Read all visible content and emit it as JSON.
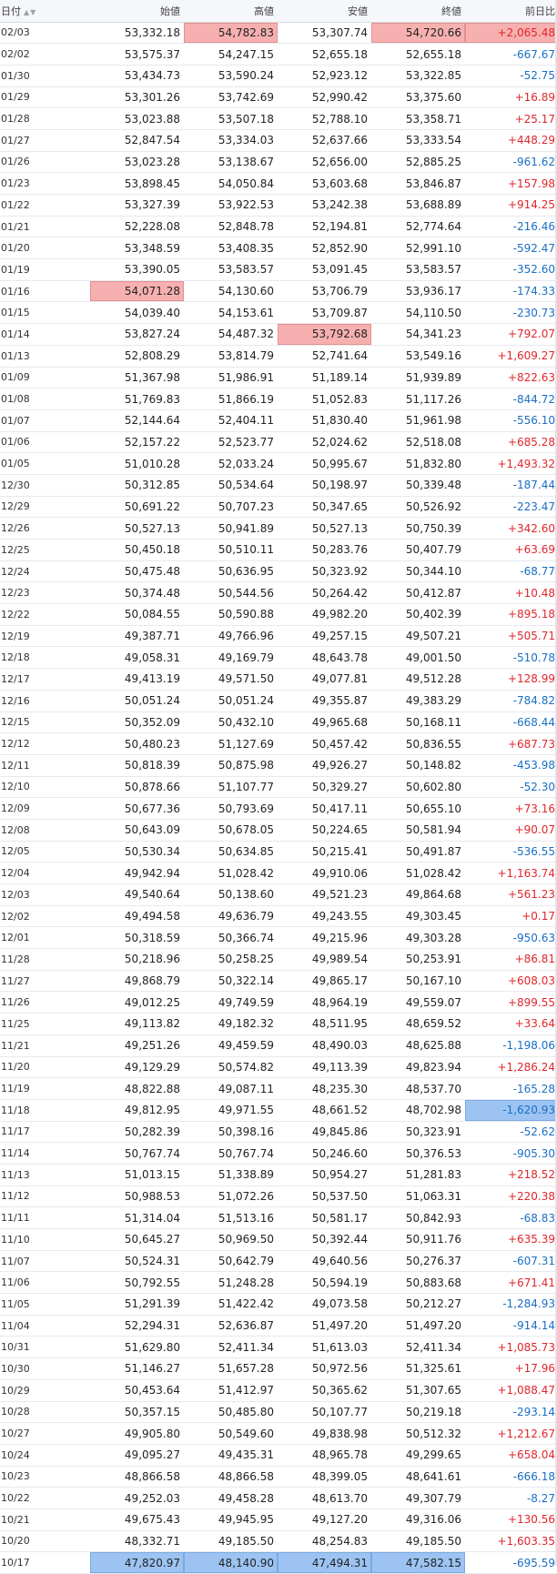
{
  "table": {
    "headers": {
      "date": "日付",
      "sort_icon": "▲▼",
      "open": "始値",
      "high": "高値",
      "low": "安値",
      "close": "終値",
      "change": "前日比"
    },
    "highlight_colors": {
      "high": "#f7b0b0",
      "low": "#9cc3f2",
      "up": "#e0262b",
      "down": "#1a6fc4"
    },
    "rows": [
      {
        "date": "02/03",
        "open": "53,332.18",
        "high": "54,782.83",
        "low": "53,307.74",
        "close": "54,720.66",
        "change": "+2,065.48",
        "hl": {
          "high": "hi",
          "close": "hi",
          "change": "hi"
        }
      },
      {
        "date": "02/02",
        "open": "53,575.37",
        "high": "54,247.15",
        "low": "52,655.18",
        "close": "52,655.18",
        "change": "-667.67"
      },
      {
        "date": "01/30",
        "open": "53,434.73",
        "high": "53,590.24",
        "low": "52,923.12",
        "close": "53,322.85",
        "change": "-52.75"
      },
      {
        "date": "01/29",
        "open": "53,301.26",
        "high": "53,742.69",
        "low": "52,990.42",
        "close": "53,375.60",
        "change": "+16.89"
      },
      {
        "date": "01/28",
        "open": "53,023.88",
        "high": "53,507.18",
        "low": "52,788.10",
        "close": "53,358.71",
        "change": "+25.17"
      },
      {
        "date": "01/27",
        "open": "52,847.54",
        "high": "53,334.03",
        "low": "52,637.66",
        "close": "53,333.54",
        "change": "+448.29"
      },
      {
        "date": "01/26",
        "open": "53,023.28",
        "high": "53,138.67",
        "low": "52,656.00",
        "close": "52,885.25",
        "change": "-961.62"
      },
      {
        "date": "01/23",
        "open": "53,898.45",
        "high": "54,050.84",
        "low": "53,603.68",
        "close": "53,846.87",
        "change": "+157.98"
      },
      {
        "date": "01/22",
        "open": "53,327.39",
        "high": "53,922.53",
        "low": "53,242.38",
        "close": "53,688.89",
        "change": "+914.25"
      },
      {
        "date": "01/21",
        "open": "52,228.08",
        "high": "52,848.78",
        "low": "52,194.81",
        "close": "52,774.64",
        "change": "-216.46"
      },
      {
        "date": "01/20",
        "open": "53,348.59",
        "high": "53,408.35",
        "low": "52,852.90",
        "close": "52,991.10",
        "change": "-592.47"
      },
      {
        "date": "01/19",
        "open": "53,390.05",
        "high": "53,583.57",
        "low": "53,091.45",
        "close": "53,583.57",
        "change": "-352.60"
      },
      {
        "date": "01/16",
        "open": "54,071.28",
        "high": "54,130.60",
        "low": "53,706.79",
        "close": "53,936.17",
        "change": "-174.33",
        "hl": {
          "open": "hi"
        }
      },
      {
        "date": "01/15",
        "open": "54,039.40",
        "high": "54,153.61",
        "low": "53,709.87",
        "close": "54,110.50",
        "change": "-230.73"
      },
      {
        "date": "01/14",
        "open": "53,827.24",
        "high": "54,487.32",
        "low": "53,792.68",
        "close": "54,341.23",
        "change": "+792.07",
        "hl": {
          "low": "hi"
        }
      },
      {
        "date": "01/13",
        "open": "52,808.29",
        "high": "53,814.79",
        "low": "52,741.64",
        "close": "53,549.16",
        "change": "+1,609.27"
      },
      {
        "date": "01/09",
        "open": "51,367.98",
        "high": "51,986.91",
        "low": "51,189.14",
        "close": "51,939.89",
        "change": "+822.63"
      },
      {
        "date": "01/08",
        "open": "51,769.83",
        "high": "51,866.19",
        "low": "51,052.83",
        "close": "51,117.26",
        "change": "-844.72"
      },
      {
        "date": "01/07",
        "open": "52,144.64",
        "high": "52,404.11",
        "low": "51,830.40",
        "close": "51,961.98",
        "change": "-556.10"
      },
      {
        "date": "01/06",
        "open": "52,157.22",
        "high": "52,523.77",
        "low": "52,024.62",
        "close": "52,518.08",
        "change": "+685.28"
      },
      {
        "date": "01/05",
        "open": "51,010.28",
        "high": "52,033.24",
        "low": "50,995.67",
        "close": "51,832.80",
        "change": "+1,493.32"
      },
      {
        "date": "12/30",
        "open": "50,312.85",
        "high": "50,534.64",
        "low": "50,198.97",
        "close": "50,339.48",
        "change": "-187.44"
      },
      {
        "date": "12/29",
        "open": "50,691.22",
        "high": "50,707.23",
        "low": "50,347.65",
        "close": "50,526.92",
        "change": "-223.47"
      },
      {
        "date": "12/26",
        "open": "50,527.13",
        "high": "50,941.89",
        "low": "50,527.13",
        "close": "50,750.39",
        "change": "+342.60"
      },
      {
        "date": "12/25",
        "open": "50,450.18",
        "high": "50,510.11",
        "low": "50,283.76",
        "close": "50,407.79",
        "change": "+63.69"
      },
      {
        "date": "12/24",
        "open": "50,475.48",
        "high": "50,636.95",
        "low": "50,323.92",
        "close": "50,344.10",
        "change": "-68.77"
      },
      {
        "date": "12/23",
        "open": "50,374.48",
        "high": "50,544.56",
        "low": "50,264.42",
        "close": "50,412.87",
        "change": "+10.48"
      },
      {
        "date": "12/22",
        "open": "50,084.55",
        "high": "50,590.88",
        "low": "49,982.20",
        "close": "50,402.39",
        "change": "+895.18"
      },
      {
        "date": "12/19",
        "open": "49,387.71",
        "high": "49,766.96",
        "low": "49,257.15",
        "close": "49,507.21",
        "change": "+505.71"
      },
      {
        "date": "12/18",
        "open": "49,058.31",
        "high": "49,169.79",
        "low": "48,643.78",
        "close": "49,001.50",
        "change": "-510.78"
      },
      {
        "date": "12/17",
        "open": "49,413.19",
        "high": "49,571.50",
        "low": "49,077.81",
        "close": "49,512.28",
        "change": "+128.99"
      },
      {
        "date": "12/16",
        "open": "50,051.24",
        "high": "50,051.24",
        "low": "49,355.87",
        "close": "49,383.29",
        "change": "-784.82"
      },
      {
        "date": "12/15",
        "open": "50,352.09",
        "high": "50,432.10",
        "low": "49,965.68",
        "close": "50,168.11",
        "change": "-668.44"
      },
      {
        "date": "12/12",
        "open": "50,480.23",
        "high": "51,127.69",
        "low": "50,457.42",
        "close": "50,836.55",
        "change": "+687.73"
      },
      {
        "date": "12/11",
        "open": "50,818.39",
        "high": "50,875.98",
        "low": "49,926.27",
        "close": "50,148.82",
        "change": "-453.98"
      },
      {
        "date": "12/10",
        "open": "50,878.66",
        "high": "51,107.77",
        "low": "50,329.27",
        "close": "50,602.80",
        "change": "-52.30"
      },
      {
        "date": "12/09",
        "open": "50,677.36",
        "high": "50,793.69",
        "low": "50,417.11",
        "close": "50,655.10",
        "change": "+73.16"
      },
      {
        "date": "12/08",
        "open": "50,643.09",
        "high": "50,678.05",
        "low": "50,224.65",
        "close": "50,581.94",
        "change": "+90.07"
      },
      {
        "date": "12/05",
        "open": "50,530.34",
        "high": "50,634.85",
        "low": "50,215.41",
        "close": "50,491.87",
        "change": "-536.55"
      },
      {
        "date": "12/04",
        "open": "49,942.94",
        "high": "51,028.42",
        "low": "49,910.06",
        "close": "51,028.42",
        "change": "+1,163.74"
      },
      {
        "date": "12/03",
        "open": "49,540.64",
        "high": "50,138.60",
        "low": "49,521.23",
        "close": "49,864.68",
        "change": "+561.23"
      },
      {
        "date": "12/02",
        "open": "49,494.58",
        "high": "49,636.79",
        "low": "49,243.55",
        "close": "49,303.45",
        "change": "+0.17"
      },
      {
        "date": "12/01",
        "open": "50,318.59",
        "high": "50,366.74",
        "low": "49,215.96",
        "close": "49,303.28",
        "change": "-950.63"
      },
      {
        "date": "11/28",
        "open": "50,218.96",
        "high": "50,258.25",
        "low": "49,989.54",
        "close": "50,253.91",
        "change": "+86.81"
      },
      {
        "date": "11/27",
        "open": "49,868.79",
        "high": "50,322.14",
        "low": "49,865.17",
        "close": "50,167.10",
        "change": "+608.03"
      },
      {
        "date": "11/26",
        "open": "49,012.25",
        "high": "49,749.59",
        "low": "48,964.19",
        "close": "49,559.07",
        "change": "+899.55"
      },
      {
        "date": "11/25",
        "open": "49,113.82",
        "high": "49,182.32",
        "low": "48,511.95",
        "close": "48,659.52",
        "change": "+33.64"
      },
      {
        "date": "11/21",
        "open": "49,251.26",
        "high": "49,459.59",
        "low": "48,490.03",
        "close": "48,625.88",
        "change": "-1,198.06"
      },
      {
        "date": "11/20",
        "open": "49,129.29",
        "high": "50,574.82",
        "low": "49,113.39",
        "close": "49,823.94",
        "change": "+1,286.24"
      },
      {
        "date": "11/19",
        "open": "48,822.88",
        "high": "49,087.11",
        "low": "48,235.30",
        "close": "48,537.70",
        "change": "-165.28"
      },
      {
        "date": "11/18",
        "open": "49,812.95",
        "high": "49,971.55",
        "low": "48,661.52",
        "close": "48,702.98",
        "change": "-1,620.93",
        "hl": {
          "change": "lo"
        }
      },
      {
        "date": "11/17",
        "open": "50,282.39",
        "high": "50,398.16",
        "low": "49,845.86",
        "close": "50,323.91",
        "change": "-52.62"
      },
      {
        "date": "11/14",
        "open": "50,767.74",
        "high": "50,767.74",
        "low": "50,246.60",
        "close": "50,376.53",
        "change": "-905.30"
      },
      {
        "date": "11/13",
        "open": "51,013.15",
        "high": "51,338.89",
        "low": "50,954.27",
        "close": "51,281.83",
        "change": "+218.52"
      },
      {
        "date": "11/12",
        "open": "50,988.53",
        "high": "51,072.26",
        "low": "50,537.50",
        "close": "51,063.31",
        "change": "+220.38"
      },
      {
        "date": "11/11",
        "open": "51,314.04",
        "high": "51,513.16",
        "low": "50,581.17",
        "close": "50,842.93",
        "change": "-68.83"
      },
      {
        "date": "11/10",
        "open": "50,645.27",
        "high": "50,969.50",
        "low": "50,392.44",
        "close": "50,911.76",
        "change": "+635.39"
      },
      {
        "date": "11/07",
        "open": "50,524.31",
        "high": "50,642.79",
        "low": "49,640.56",
        "close": "50,276.37",
        "change": "-607.31"
      },
      {
        "date": "11/06",
        "open": "50,792.55",
        "high": "51,248.28",
        "low": "50,594.19",
        "close": "50,883.68",
        "change": "+671.41"
      },
      {
        "date": "11/05",
        "open": "51,291.39",
        "high": "51,422.42",
        "low": "49,073.58",
        "close": "50,212.27",
        "change": "-1,284.93"
      },
      {
        "date": "11/04",
        "open": "52,294.31",
        "high": "52,636.87",
        "low": "51,497.20",
        "close": "51,497.20",
        "change": "-914.14"
      },
      {
        "date": "10/31",
        "open": "51,629.80",
        "high": "52,411.34",
        "low": "51,613.03",
        "close": "52,411.34",
        "change": "+1,085.73"
      },
      {
        "date": "10/30",
        "open": "51,146.27",
        "high": "51,657.28",
        "low": "50,972.56",
        "close": "51,325.61",
        "change": "+17.96"
      },
      {
        "date": "10/29",
        "open": "50,453.64",
        "high": "51,412.97",
        "low": "50,365.62",
        "close": "51,307.65",
        "change": "+1,088.47"
      },
      {
        "date": "10/28",
        "open": "50,357.15",
        "high": "50,485.80",
        "low": "50,107.77",
        "close": "50,219.18",
        "change": "-293.14"
      },
      {
        "date": "10/27",
        "open": "49,905.80",
        "high": "50,549.60",
        "low": "49,838.98",
        "close": "50,512.32",
        "change": "+1,212.67"
      },
      {
        "date": "10/24",
        "open": "49,095.27",
        "high": "49,435.31",
        "low": "48,965.78",
        "close": "49,299.65",
        "change": "+658.04"
      },
      {
        "date": "10/23",
        "open": "48,866.58",
        "high": "48,866.58",
        "low": "48,399.05",
        "close": "48,641.61",
        "change": "-666.18"
      },
      {
        "date": "10/22",
        "open": "49,252.03",
        "high": "49,458.28",
        "low": "48,613.70",
        "close": "49,307.79",
        "change": "-8.27"
      },
      {
        "date": "10/21",
        "open": "49,675.43",
        "high": "49,945.95",
        "low": "49,127.20",
        "close": "49,316.06",
        "change": "+130.56"
      },
      {
        "date": "10/20",
        "open": "48,332.71",
        "high": "49,185.50",
        "low": "48,254.83",
        "close": "49,185.50",
        "change": "+1,603.35"
      },
      {
        "date": "10/17",
        "open": "47,820.97",
        "high": "48,140.90",
        "low": "47,494.31",
        "close": "47,582.15",
        "change": "-695.59",
        "hl": {
          "open": "lo",
          "high": "lo",
          "low": "lo",
          "close": "lo"
        }
      }
    ]
  }
}
